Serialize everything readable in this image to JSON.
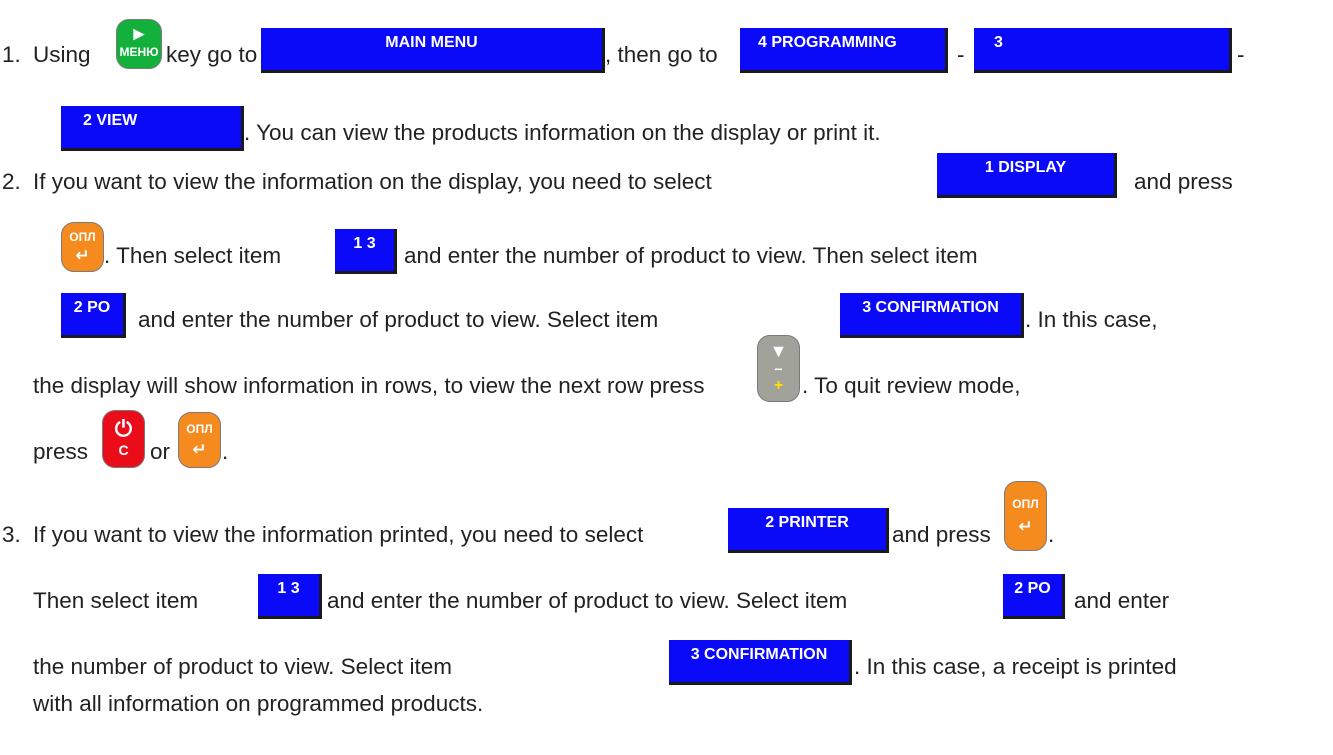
{
  "colors": {
    "screen_bg": "#0a0af8",
    "screen_text": "#ffffff",
    "key_opl": "#f58a1f",
    "key_menu": "#14b03c",
    "key_cancel": "#ea0d19",
    "key_down": "#a1a29a"
  },
  "keys": {
    "menu": {
      "label": "МЕНЮ",
      "symbol": "►"
    },
    "opl": {
      "label": "ОПЛ",
      "symbol": "↵"
    },
    "cancel": {
      "label": "C",
      "symbol": "⏻"
    },
    "down": {
      "symbol_top": "▼",
      "minus": "−",
      "plus": "+"
    }
  },
  "screens": {
    "main_menu": "MAIN MENU",
    "programming": "4 PROGRAMMING",
    "item3": "3",
    "view": "2 VIEW",
    "display": "1 DISPLAY",
    "item13": "1 3",
    "po": "2 PO",
    "confirmation": "3 CONFIRMATION",
    "printer": "2 PRINTER"
  },
  "steps": [
    {
      "number": "1.",
      "using": "Using",
      "key_go_to": "key go to",
      "then_go_to": ", then go to",
      "dash": "-",
      "view_tail": ". You can view the products information on the display or print it."
    },
    {
      "number": "2.",
      "intro": "If you want to view the information on the display, you need to select",
      "and_press": "and press",
      "then_select": ". Then select item",
      "enter_then": "and enter the number of product to view. Then select item",
      "enter_select": "and enter the number of product to view. Select item",
      "in_this_case": ". In this case,",
      "rows_text": "the display will show information in rows, to view the next row press",
      "quit": ". To quit review mode,",
      "press": "press",
      "or": "or",
      "period": "."
    },
    {
      "number": "3.",
      "intro": "If you want to view the information printed, you need to select",
      "and_press": "and press",
      "period": ".",
      "then_select": "Then select item",
      "enter_select": "and enter the number of product to view. Select item",
      "and_enter": "and enter",
      "num_product": "the number of product to view. Select item",
      "in_this_case": ". In this case, a receipt is printed",
      "last_line": "with all information on programmed products."
    }
  ]
}
